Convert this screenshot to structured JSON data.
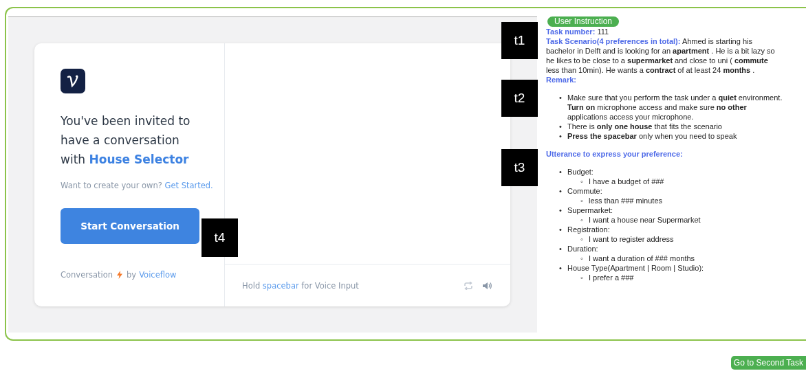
{
  "chat_widget": {
    "invitation": "You've been invited to have a conversation with",
    "assistant_name": "House Selector",
    "create_prompt": "Want to create your own?",
    "create_link": "Get Started.",
    "start_button": "Start Conversation",
    "footer_text": "Conversation",
    "footer_by": "by",
    "footer_brand": "Voiceflow",
    "voice_hint_before": "Hold",
    "voice_hint_key": "spacebar",
    "voice_hint_after": "for Voice Input"
  },
  "instructions": {
    "badge": "User Instruction",
    "task_number_label": "Task number:",
    "task_number": "111",
    "scenario_label": "Task Scenario(4 preferences in total):",
    "scenario": "Ahmed is starting his bachelor in Delft and is looking for an **apartment** . He is a bit lazy so he likes to be close to a **supermarket** and close to uni ( **commute** less than 10min). He wants a **contract** of at least 24 **months** .",
    "remark_label": "Remark:",
    "bullet": "•",
    "sub_bullet": "◦",
    "remarks": [
      "Make sure that you perform the task under a **quiet** environment. **Turn on** microphone access and make sure **no other** applications access your microphone.",
      "There is **only one house** that fits the scenario",
      "**Press the spacebar** only when you need to speak"
    ],
    "utterance_label": "Utterance to express your preference:",
    "utterances": [
      {
        "label": "Budget:",
        "example": "I have a budget of ###"
      },
      {
        "label": "Commute:",
        "example": "less than ### minutes"
      },
      {
        "label": "Supermarket:",
        "example": "I want a house near Supermarket"
      },
      {
        "label": "Registration:",
        "example": "I want to register address"
      },
      {
        "label": "Duration:",
        "example": "I want a duration of ### months"
      },
      {
        "label": "House Type(Apartment | Room | Studio):",
        "example": "I prefer a ###"
      }
    ]
  },
  "tags": [
    "t1",
    "t2",
    "t3",
    "t4"
  ],
  "next_button": "Go to Second Task"
}
